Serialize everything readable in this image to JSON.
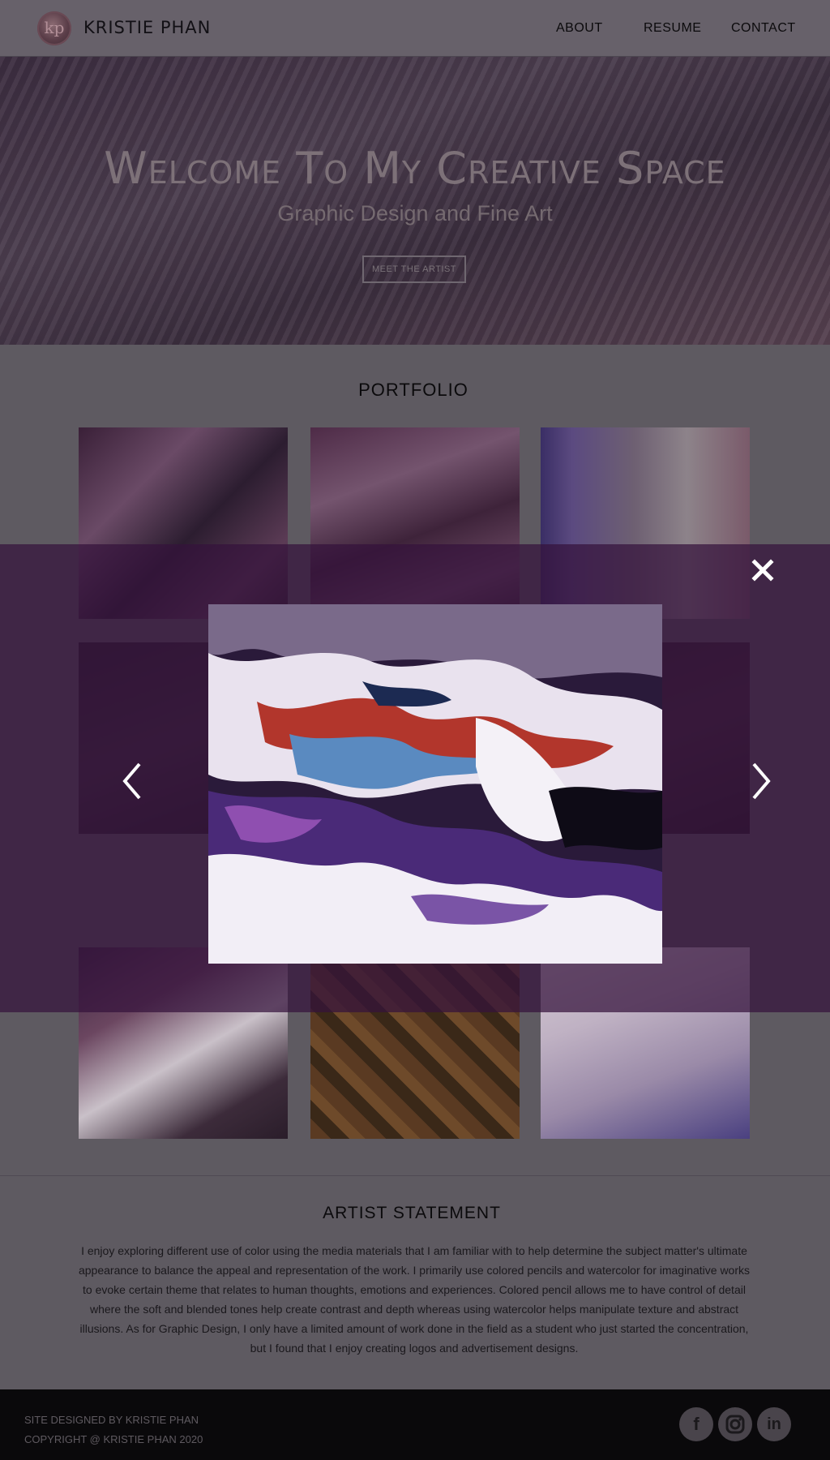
{
  "header": {
    "logo_text": "kp",
    "brand": "KRISTIE PHAN",
    "nav": {
      "about": "ABOUT",
      "resume": "RESUME",
      "contact": "CONTACT"
    }
  },
  "hero": {
    "title": "Welcome To My Creative Space",
    "subtitle": "Graphic Design and Fine Art",
    "button": "MEET THE ARTIST"
  },
  "portfolio": {
    "title": "PORTFOLIO"
  },
  "statement": {
    "title": "ARTIST STATEMENT",
    "body": "I enjoy exploring different use of color using the media materials that I am familiar with to help determine the subject matter's ultimate appearance to balance the appeal and representation of the work. I primarily use colored pencils and watercolor for imaginative works to evoke certain theme that relates to human thoughts, emotions and experiences. Colored pencil allows me to have control of detail where the soft and blended tones help create contrast and depth whereas using watercolor helps manipulate texture and abstract illusions. As for Graphic Design, I only have a limited amount of work done in the field as a student who just started the concentration, but I found that I enjoy creating logos and advertisement designs."
  },
  "footer": {
    "line1": "SITE DESIGNED BY KRISTIE PHAN",
    "line2": "COPYRIGHT @ KRISTIE PHAN 2020",
    "social": [
      "facebook-icon",
      "instagram-icon",
      "linkedin-icon"
    ]
  },
  "lightbox": {
    "overlay_color": "#34123c",
    "icons": {
      "close": "close-icon",
      "prev": "chevron-left-icon",
      "next": "chevron-right-icon"
    }
  }
}
